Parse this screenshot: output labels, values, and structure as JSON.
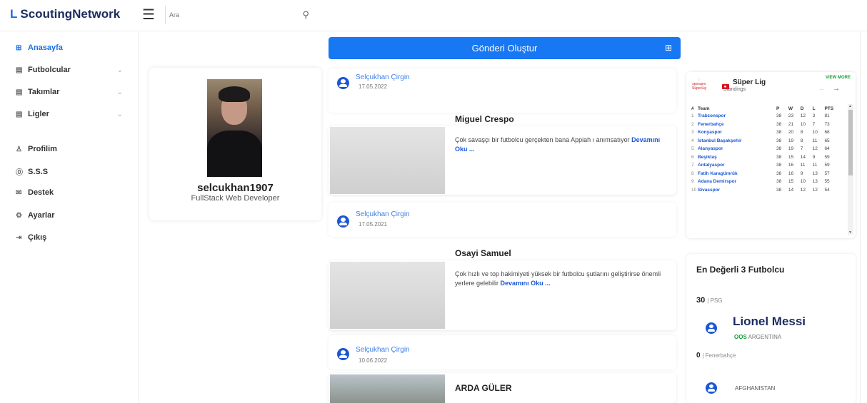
{
  "app": {
    "logo_mark": "L",
    "logo_text": "ScoutingNetwork"
  },
  "search": {
    "placeholder": "Ara"
  },
  "sidebar": {
    "items": [
      {
        "label": "Anasayfa",
        "icon": "grid-icon",
        "active": true
      },
      {
        "label": "Futbolcular",
        "icon": "list-icon",
        "chevron": true
      },
      {
        "label": "Takımlar",
        "icon": "list-icon",
        "chevron": true
      },
      {
        "label": "Ligler",
        "icon": "list-icon",
        "chevron": true
      },
      {
        "label": "Profilim",
        "icon": "user-icon"
      },
      {
        "label": "S.S.S",
        "icon": "question-icon"
      },
      {
        "label": "Destek",
        "icon": "mail-icon"
      },
      {
        "label": "Ayarlar",
        "icon": "gear-icon"
      },
      {
        "label": "Çıkış",
        "icon": "logout-icon"
      }
    ]
  },
  "profile": {
    "username": "selcukhan1907",
    "role": "FullStack Web Developer"
  },
  "create_post": {
    "label": "Gönderi Oluştur"
  },
  "posts": [
    {
      "author": "Selçukhan Çirgin",
      "date": "17.05.2022",
      "title": "Miguel Crespo",
      "text": "Çok savaşçı bir futbolcu gerçekten bana Appiah ı anımsatıyor",
      "read_more": "Devamını Oku ..."
    },
    {
      "author": "Selçukhan Çirgin",
      "date": "17.05.2021",
      "title": "Osayi Samuel",
      "text": "Çok hızlı ve top hakimiyeti yüksek bir futbolcu şutlarını geliştirirse önemli yerlere gelebilir",
      "read_more": "Devamını Oku ..."
    },
    {
      "author": "Selçukhan Çirgin",
      "date": "10.06.2022",
      "title": "ARDA GÜLER"
    }
  ],
  "standings": {
    "logo_text": "sporspro\nSüperLig",
    "title": "Süper Lig",
    "subtitle": "Standings",
    "view_more": "VIEW MORE",
    "headers": [
      "#",
      "Team",
      "P",
      "W",
      "D",
      "L",
      "PTS"
    ],
    "rows": [
      [
        "1",
        "Trabzonspor",
        "38",
        "23",
        "12",
        "3",
        "81"
      ],
      [
        "2",
        "Fenerbahçe",
        "38",
        "21",
        "10",
        "7",
        "73"
      ],
      [
        "3",
        "Konyaspor",
        "38",
        "20",
        "8",
        "10",
        "68"
      ],
      [
        "4",
        "İstanbul Başakşehir",
        "38",
        "19",
        "8",
        "11",
        "65"
      ],
      [
        "5",
        "Alanyaspor",
        "38",
        "19",
        "7",
        "12",
        "64"
      ],
      [
        "6",
        "Beşiktaş",
        "38",
        "15",
        "14",
        "9",
        "59"
      ],
      [
        "7",
        "Antalyaspor",
        "38",
        "16",
        "11",
        "11",
        "59"
      ],
      [
        "8",
        "Fatih Karagümrük",
        "38",
        "16",
        "9",
        "13",
        "57"
      ],
      [
        "9",
        "Adana Demirspor",
        "38",
        "15",
        "10",
        "13",
        "55"
      ],
      [
        "10",
        "Sivasspor",
        "38",
        "14",
        "12",
        "12",
        "54"
      ]
    ]
  },
  "valuable": {
    "title": "En Değerli 3 Futbolcu",
    "players": [
      {
        "value": "30",
        "club": "PSG",
        "name": "Lionel Messi",
        "position": "OOS",
        "country": "ARGENTINA"
      },
      {
        "value": "0",
        "club": "Fenerbahçe",
        "name": "",
        "position": "",
        "country": "AFGHANISTAN"
      }
    ]
  },
  "colors": {
    "accent": "#1877f2",
    "brand": "#1a2b5e",
    "link": "#1a56d6",
    "green": "#1a9e3a"
  }
}
